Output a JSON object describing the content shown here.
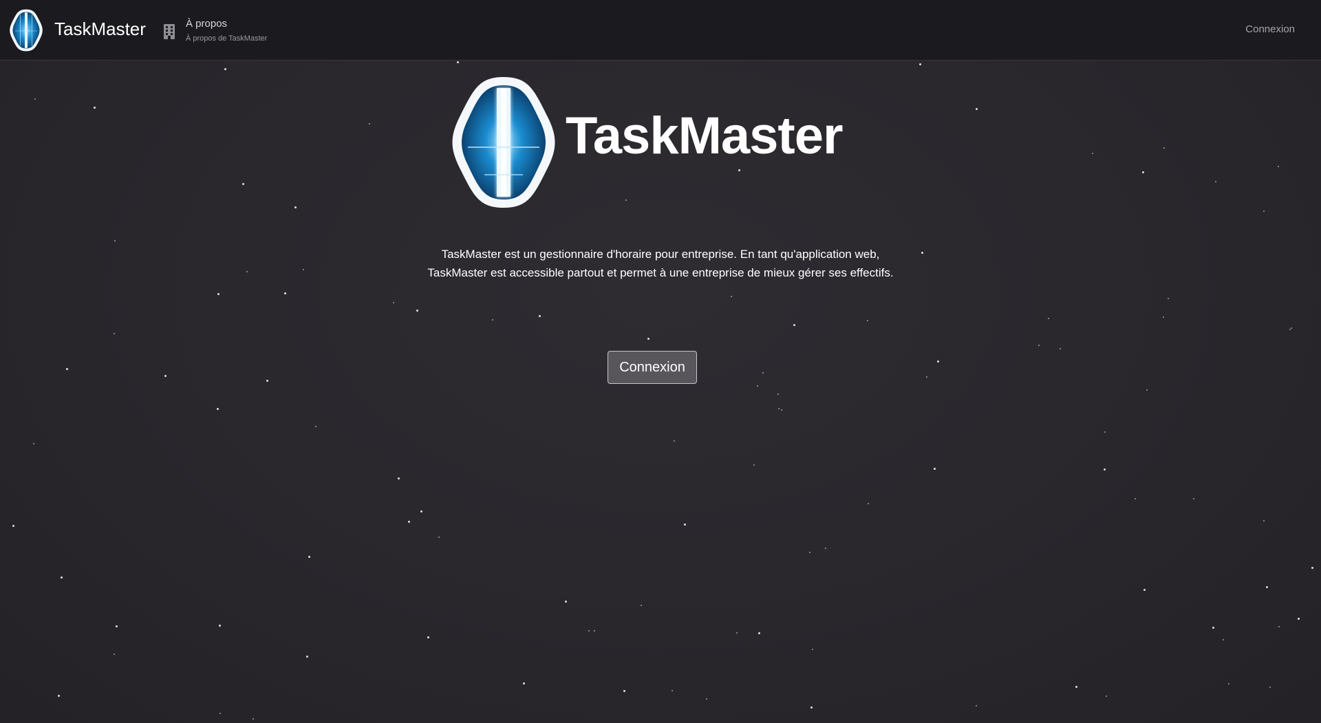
{
  "navbar": {
    "brand": "TaskMaster",
    "about": {
      "title": "À propos",
      "subtitle": "À propos de TaskMaster",
      "icon": "building-icon"
    },
    "login": "Connexion"
  },
  "hero": {
    "brand": "TaskMaster",
    "description": "TaskMaster est un gestionnaire d'horaire pour entreprise. En tant qu'application web, TaskMaster est accessible partout et permet à une entreprise de mieux gérer ses effectifs.",
    "button_label": "Connexion"
  },
  "colors": {
    "background": "#2b292f",
    "navbar": "#1b1a1e",
    "logo_blue": "#1a8ccf",
    "button": "#58565b"
  }
}
